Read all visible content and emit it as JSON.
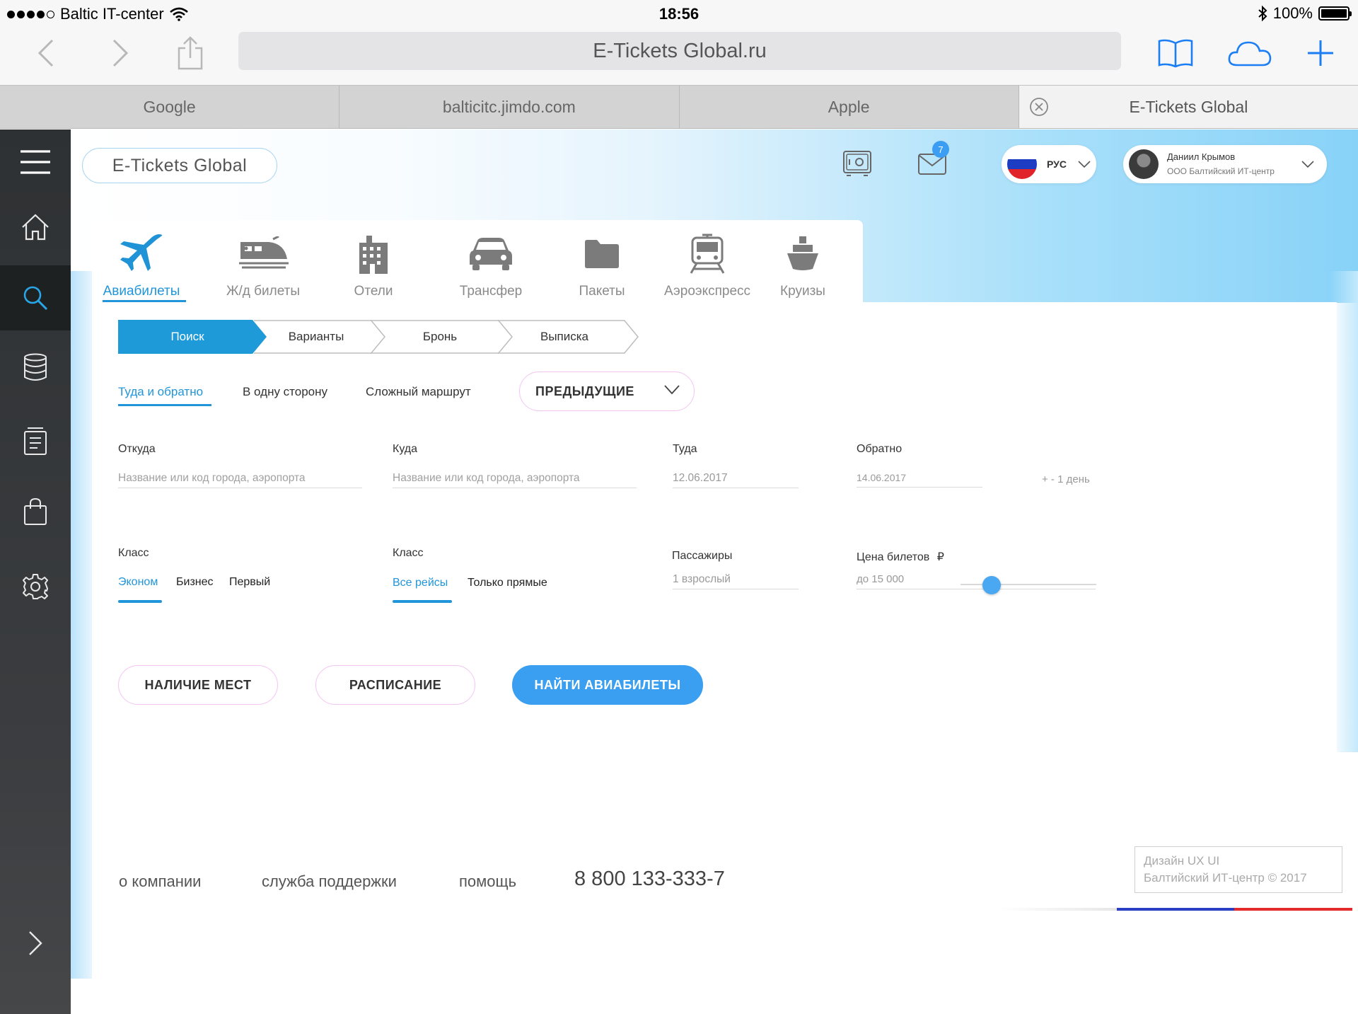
{
  "status_bar": {
    "carrier": "Baltic IT-center",
    "time": "18:56",
    "battery": "100%"
  },
  "browser": {
    "url": "E-Tickets Global.ru",
    "tabs": [
      {
        "label": "Google"
      },
      {
        "label": "balticitc.jimdo.com"
      },
      {
        "label": "Apple"
      },
      {
        "label": "E-Tickets Global"
      }
    ]
  },
  "sidebar": {
    "items": [
      {
        "icon": "menu-icon"
      },
      {
        "icon": "home-icon"
      },
      {
        "icon": "search-icon",
        "active": true
      },
      {
        "icon": "database-icon"
      },
      {
        "icon": "documents-icon"
      },
      {
        "icon": "shopping-bag-icon"
      },
      {
        "icon": "gear-icon"
      },
      {
        "icon": "chevron-right-icon"
      }
    ]
  },
  "header": {
    "logo": "E-Tickets Global",
    "messages_count": "7",
    "language": "РУС",
    "user_name": "Даниил Крымов",
    "user_org": "ООО Балтийский ИТ-центр"
  },
  "categories": [
    {
      "label": "Авиабилеты",
      "icon": "airplane-icon",
      "active": true
    },
    {
      "label": "Ж/д билеты",
      "icon": "train-icon"
    },
    {
      "label": "Отели",
      "icon": "hotel-icon"
    },
    {
      "label": "Трансфер",
      "icon": "car-icon"
    },
    {
      "label": "Пакеты",
      "icon": "folder-icon"
    },
    {
      "label": "Аэроэкспресс",
      "icon": "aeroexpress-icon"
    },
    {
      "label": "Круизы",
      "icon": "ship-icon"
    }
  ],
  "steps": [
    {
      "label": "Поиск",
      "active": true
    },
    {
      "label": "Варианты"
    },
    {
      "label": "Бронь"
    },
    {
      "label": "Выписка"
    }
  ],
  "trip_types": [
    {
      "label": "Туда и обратно",
      "active": true
    },
    {
      "label": "В одну сторону"
    },
    {
      "label": "Сложный маршрут"
    }
  ],
  "previous_label": "ПРЕДЫДУЩИЕ",
  "form": {
    "from_label": "Откуда",
    "from_placeholder": "Название или код города, аэропорта",
    "to_label": "Куда",
    "to_placeholder": "Название или код города, аэропорта",
    "depart_label": "Туда",
    "depart_value": "12.06.2017",
    "return_label": "Обратно",
    "return_value": "14.06.2017",
    "flex_days": "+ - 1 день",
    "class_label": "Класс",
    "class_options": [
      {
        "label": "Эконом",
        "active": true
      },
      {
        "label": "Бизнес"
      },
      {
        "label": "Первый"
      }
    ],
    "flights_label": "Класс",
    "flights_options": [
      {
        "label": "Все рейсы",
        "active": true
      },
      {
        "label": "Только прямые"
      }
    ],
    "passengers_label": "Пассажиры",
    "passengers_value": "1 взрослый",
    "price_label": "Цена билетов",
    "price_currency": "₽",
    "price_value": "до 15 000",
    "price_slider_fraction": 0.23
  },
  "buttons": {
    "availability": "НАЛИЧИЕ МЕСТ",
    "schedule": "РАСПИСАНИЕ",
    "search": "НАЙТИ АВИАБИЛЕТЫ"
  },
  "footer": {
    "links": [
      {
        "label": "о компании"
      },
      {
        "label": "служба поддержки"
      },
      {
        "label": "помощь"
      }
    ],
    "phone": "8 800 133-333-7",
    "credit_line1": "Дизайн UX UI",
    "credit_line2": "Балтийский ИТ-центр © 2017"
  },
  "colors": {
    "accent": "#2195d9",
    "primary_button": "#3a9ff0",
    "pill_border": "#f2c6f2",
    "sidebar_bg": "#2e3133"
  }
}
